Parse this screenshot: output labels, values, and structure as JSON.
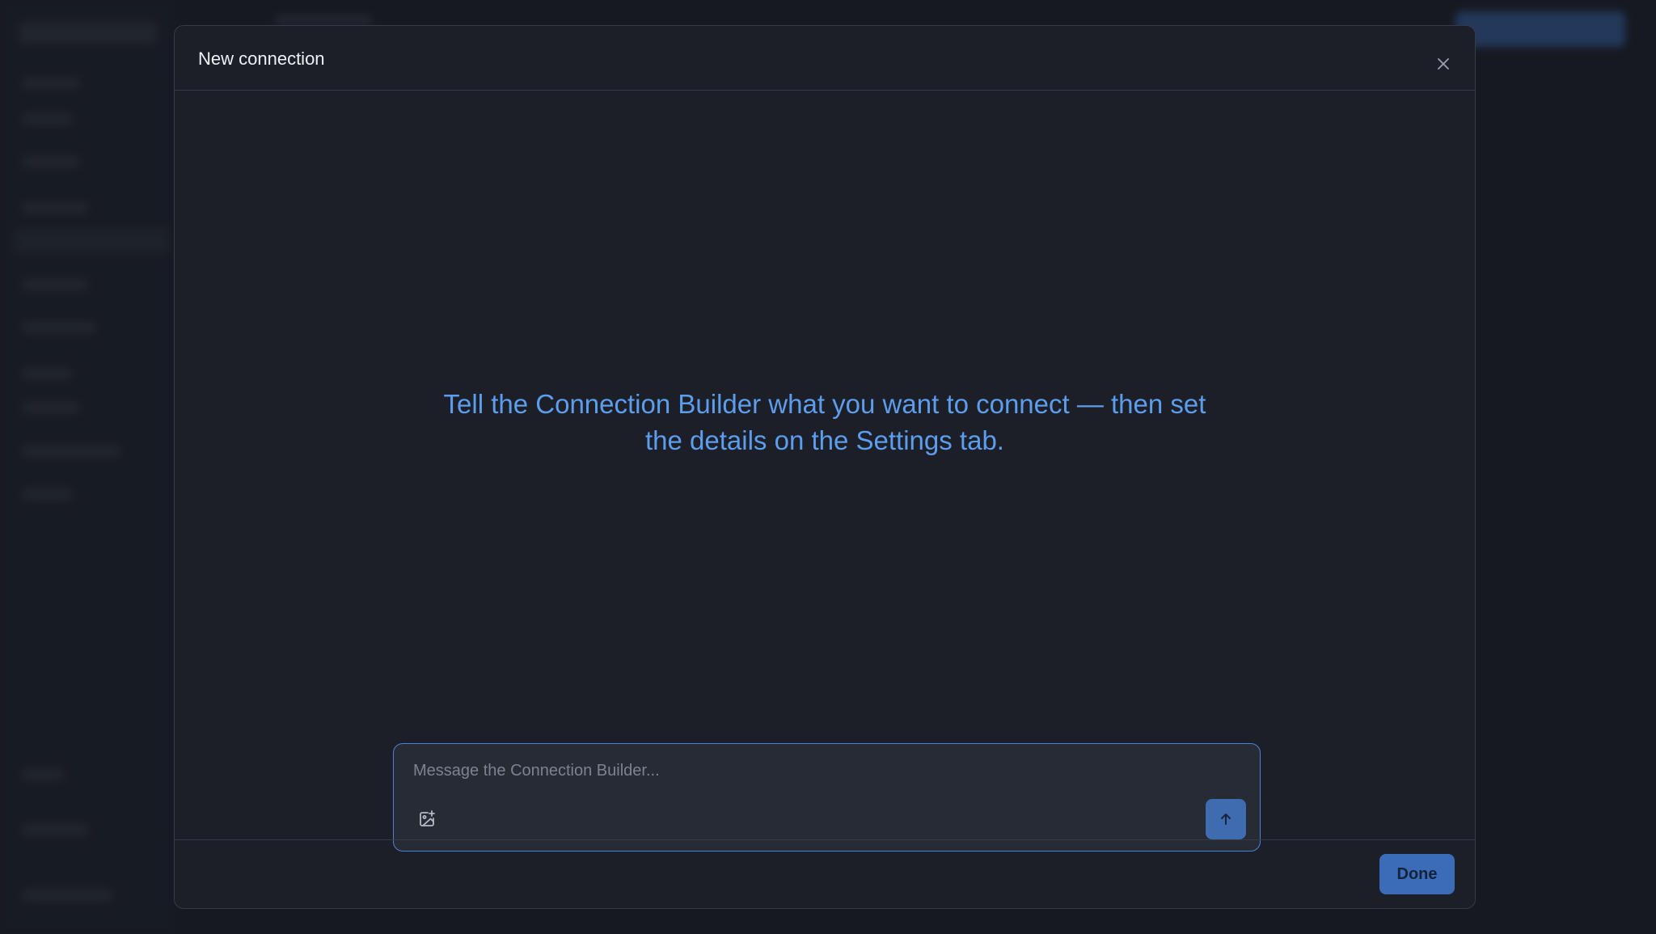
{
  "modal": {
    "title": "New connection",
    "empty_message_line1": "Tell the Connection Builder what you want to connect — then set",
    "empty_message_line2": "the details on the Settings tab.",
    "composer": {
      "placeholder": "Message the Connection Builder...",
      "value": ""
    },
    "footer": {
      "done_label": "Done"
    }
  },
  "icons": {
    "close": "close-icon",
    "attach": "image-plus-icon",
    "send": "arrow-up-icon"
  },
  "colors": {
    "accent": "#5d9ded",
    "send_button": "#3f6bb0",
    "done_button": "#3b6cb8",
    "modal_bg": "#1c1f27"
  }
}
